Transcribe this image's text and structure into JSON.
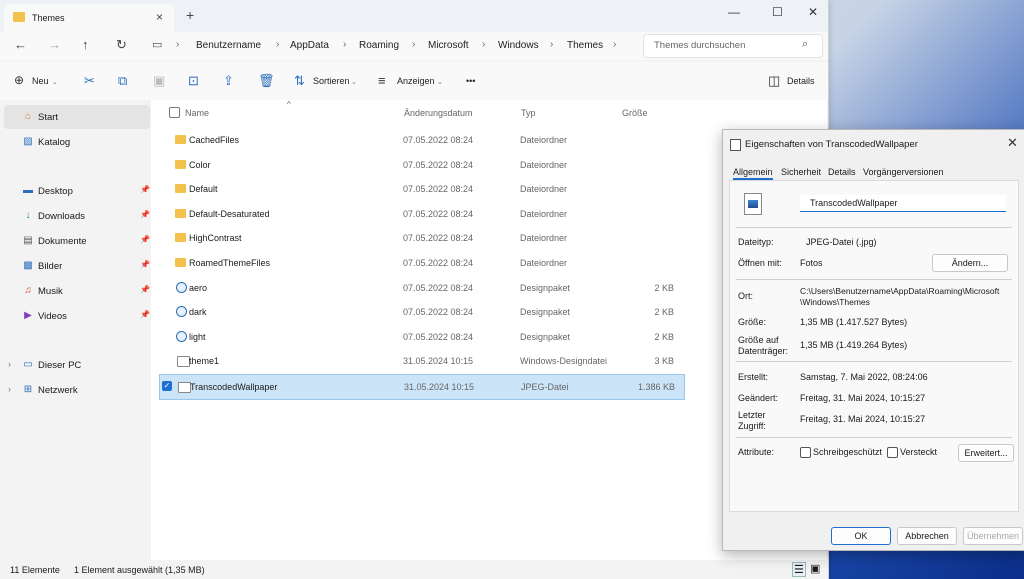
{
  "window": {
    "tab_title": "Themes",
    "breadcrumb": [
      "Benutzername",
      "AppData",
      "Roaming",
      "Microsoft",
      "Windows",
      "Themes"
    ],
    "search_placeholder": "Themes durchsuchen"
  },
  "toolbar": {
    "new_label": "Neu",
    "sort_label": "Sortieren",
    "view_label": "Anzeigen",
    "more_label": "•••",
    "details_label": "Details"
  },
  "sidebar": {
    "start": "Start",
    "catalog": "Katalog",
    "items": [
      "Desktop",
      "Downloads",
      "Dokumente",
      "Bilder",
      "Musik",
      "Videos"
    ],
    "this_pc": "Dieser PC",
    "network": "Netzwerk"
  },
  "columns": {
    "name": "Name",
    "date": "Änderungsdatum",
    "type": "Typ",
    "size": "Größe"
  },
  "files": [
    {
      "name": "CachedFiles",
      "date": "07.05.2022 08:24",
      "type": "Dateiordner",
      "size": "",
      "kind": "folder"
    },
    {
      "name": "Color",
      "date": "07.05.2022 08:24",
      "type": "Dateiordner",
      "size": "",
      "kind": "folder"
    },
    {
      "name": "Default",
      "date": "07.05.2022 08:24",
      "type": "Dateiordner",
      "size": "",
      "kind": "folder"
    },
    {
      "name": "Default-Desaturated",
      "date": "07.05.2022 08:24",
      "type": "Dateiordner",
      "size": "",
      "kind": "folder"
    },
    {
      "name": "HighContrast",
      "date": "07.05.2022 08:24",
      "type": "Dateiordner",
      "size": "",
      "kind": "folder"
    },
    {
      "name": "RoamedThemeFiles",
      "date": "07.05.2022 08:24",
      "type": "Dateiordner",
      "size": "",
      "kind": "folder"
    },
    {
      "name": "aero",
      "date": "07.05.2022 08:24",
      "type": "Designpaket",
      "size": "2 KB",
      "kind": "theme"
    },
    {
      "name": "dark",
      "date": "07.05.2022 08:24",
      "type": "Designpaket",
      "size": "2 KB",
      "kind": "theme"
    },
    {
      "name": "light",
      "date": "07.05.2022 08:24",
      "type": "Designpaket",
      "size": "2 KB",
      "kind": "theme"
    },
    {
      "name": "theme1",
      "date": "31.05.2024 10:15",
      "type": "Windows-Designdatei",
      "size": "3 KB",
      "kind": "file"
    },
    {
      "name": "TranscodedWallpaper",
      "date": "31.05.2024 10:15",
      "type": "JPEG-Datei",
      "size": "1.386 KB",
      "kind": "file"
    }
  ],
  "status": {
    "count": "11 Elemente",
    "selection": "1 Element ausgewählt (1,35 MB)"
  },
  "dialog": {
    "title": "Eigenschaften von TranscodedWallpaper",
    "tabs": [
      "Allgemein",
      "Sicherheit",
      "Details",
      "Vorgängerversionen"
    ],
    "filename": "TranscodedWallpaper",
    "filetype_label": "Dateityp:",
    "filetype": "JPEG-Datei (.jpg)",
    "openwith_label": "Öffnen mit:",
    "openwith": "Fotos",
    "change_button": "Ändern...",
    "location_label": "Ort:",
    "location": "C:\\Users\\Benutzername\\AppData\\Roaming\\Microsoft\\Windows\\Themes",
    "size_label": "Größe:",
    "size": "1,35 MB (1.417.527 Bytes)",
    "disksize_label": "Größe auf Datenträger:",
    "disksize": "1,35 MB (1.419.264 Bytes)",
    "created_label": "Erstellt:",
    "created": "Samstag, 7. Mai 2022, 08:24:06",
    "modified_label": "Geändert:",
    "modified": "Freitag, 31. Mai 2024, 10:15:27",
    "accessed_label": "Letzter Zugriff:",
    "accessed": "Freitag, 31. Mai 2024, 10:15:27",
    "attributes_label": "Attribute:",
    "readonly_label": "Schreibgeschützt",
    "hidden_label": "Versteckt",
    "advanced_button": "Erweitert...",
    "ok": "OK",
    "cancel": "Abbrechen",
    "apply": "Übernehmen"
  },
  "colors": {
    "accent": "#1f6fd1",
    "folder": "#f3c14e",
    "selection": "#cce4f7"
  }
}
